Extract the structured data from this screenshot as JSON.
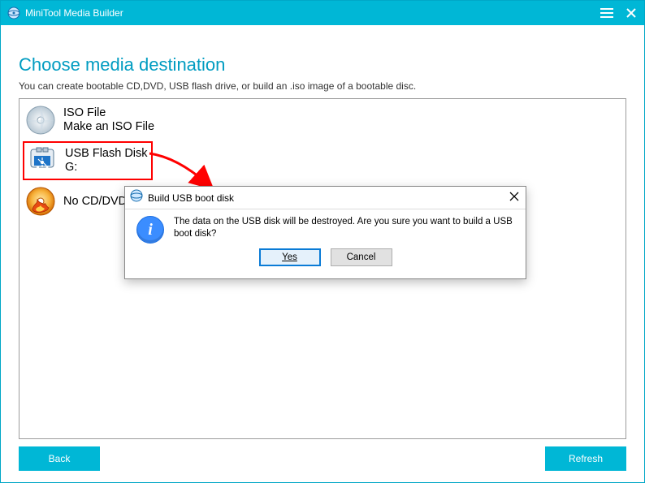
{
  "titlebar": {
    "title": "MiniTool Media Builder"
  },
  "page": {
    "heading": "Choose media destination",
    "subheading": "You can create bootable CD,DVD, USB flash drive, or build an .iso image of a bootable disc."
  },
  "options": {
    "iso": {
      "title": "ISO File",
      "sub": "Make an ISO File"
    },
    "usb": {
      "title": "USB Flash Disk",
      "sub": "G:"
    },
    "cd": {
      "title": "No CD/DVD"
    }
  },
  "dialog": {
    "title": "Build USB boot disk",
    "message": "The data on the USB disk will be destroyed. Are you sure you want to build a USB boot disk?",
    "yes": "Yes",
    "cancel": "Cancel"
  },
  "footer": {
    "back": "Back",
    "refresh": "Refresh"
  }
}
